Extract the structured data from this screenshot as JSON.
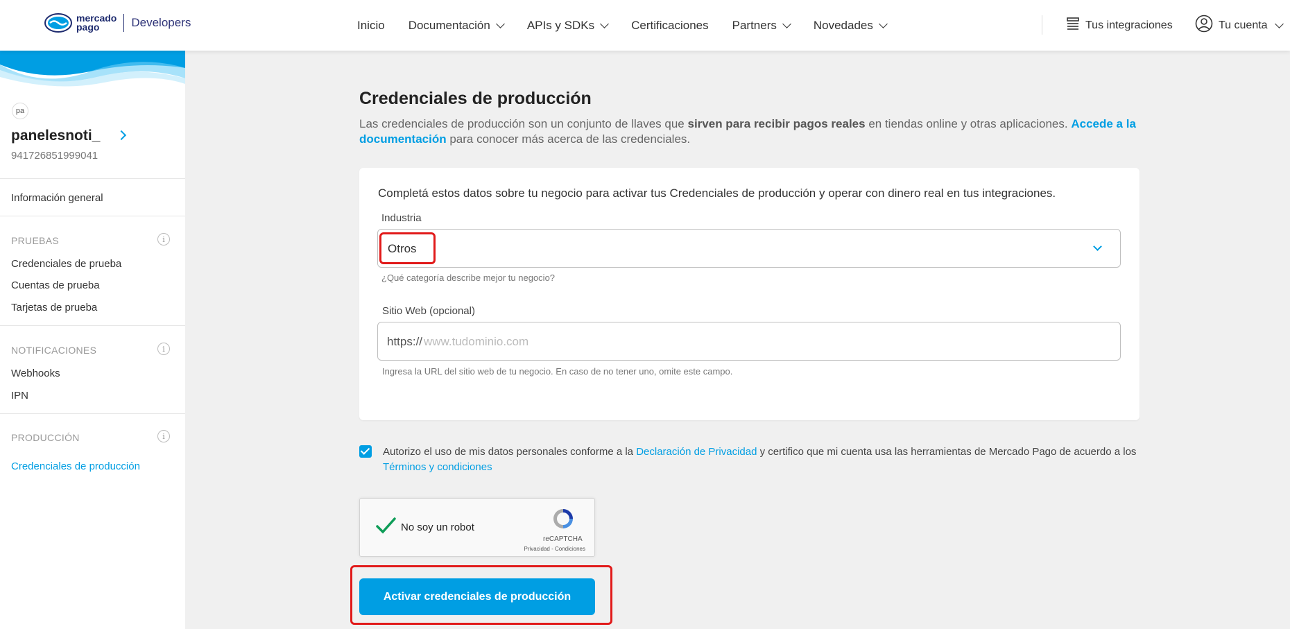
{
  "header": {
    "logo_line1": "mercado",
    "logo_line2": "pago",
    "logo_product": "Developers",
    "nav": [
      {
        "label": "Inicio",
        "dropdown": false
      },
      {
        "label": "Documentación",
        "dropdown": true
      },
      {
        "label": "APIs y SDKs",
        "dropdown": true
      },
      {
        "label": "Certificaciones",
        "dropdown": false
      },
      {
        "label": "Partners",
        "dropdown": true
      },
      {
        "label": "Novedades",
        "dropdown": true
      }
    ],
    "integrations_label": "Tus integraciones",
    "account_label": "Tu cuenta"
  },
  "sidebar": {
    "avatar_initials": "pa",
    "app_name": "panelesnoti_",
    "app_id": "941726851999041",
    "general_info": "Información general",
    "sections": [
      {
        "title": "PRUEBAS",
        "items": [
          "Credenciales de prueba",
          "Cuentas de prueba",
          "Tarjetas de prueba"
        ]
      },
      {
        "title": "NOTIFICACIONES",
        "items": [
          "Webhooks",
          "IPN"
        ]
      },
      {
        "title": "PRODUCCIÓN",
        "items": [
          "Credenciales de producción"
        ]
      }
    ],
    "active_item": "Credenciales de producción"
  },
  "main": {
    "title": "Credenciales de producción",
    "desc_part1": "Las credenciales de producción son un conjunto de llaves que ",
    "desc_bold": "sirven para recibir pagos reales",
    "desc_part2": " en tiendas online y otras aplicaciones. ",
    "desc_link": "Accede a la documentación",
    "desc_part3": " para conocer más acerca de las credenciales.",
    "form": {
      "intro": "Completá estos datos sobre tu negocio para activar tus Credenciales de producción y operar con dinero real en tus integraciones.",
      "industry_label": "Industria",
      "industry_value": "Otros",
      "industry_help": "¿Qué categoría describe mejor tu negocio?",
      "website_label": "Sitio Web (opcional)",
      "website_prefix": "https://",
      "website_placeholder": "www.tudominio.com",
      "website_help": "Ingresa la URL del sitio web de tu negocio. En caso de no tener uno, omite este campo."
    },
    "consent": {
      "checked": true,
      "part1": "Autorizo el uso de mis datos personales conforme a la ",
      "privacy_link": "Declaración de Privacidad",
      "part2": " y certifico que mi cuenta usa las herramientas de Mercado Pago de acuerdo a los ",
      "terms_link": "Términos y condiciones"
    },
    "recaptcha": {
      "label": "No soy un robot",
      "brand": "reCAPTCHA",
      "links": "Privacidad - Condiciones"
    },
    "submit_label": "Activar credenciales de producción"
  },
  "colors": {
    "accent": "#009ee3",
    "annotation": "#e11a1a",
    "brand_navy": "#1d2a6e"
  }
}
